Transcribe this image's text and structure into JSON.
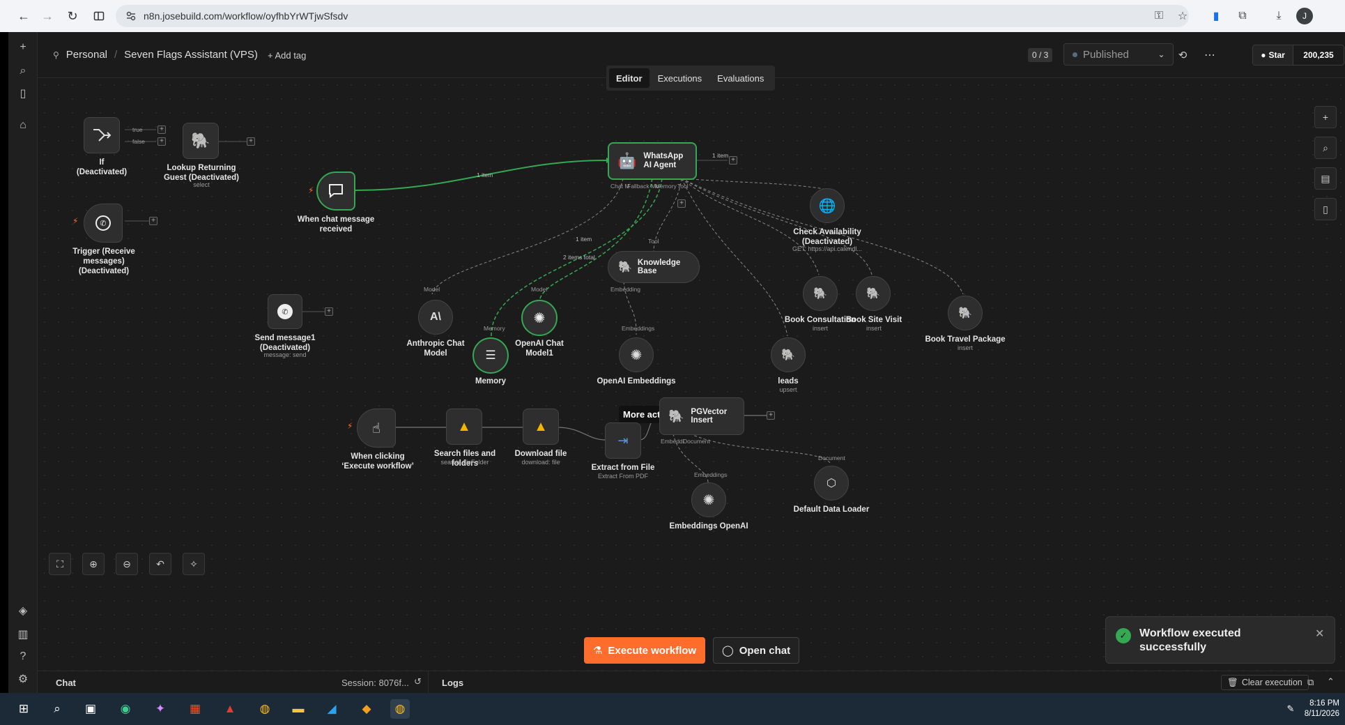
{
  "browser": {
    "url": "n8n.josebuild.com/workflow/oyfhbYrWTjwSfsdv",
    "profile_initial": "J"
  },
  "header": {
    "project": "Personal",
    "workflow_name": "Seven Flags Assistant (VPS)",
    "add_tag": "+ Add tag",
    "counter": "0 / 3",
    "published_label": "Published",
    "github_star": "Star",
    "github_count": "200,235"
  },
  "tabs": [
    {
      "label": "Editor",
      "active": true
    },
    {
      "label": "Executions",
      "active": false
    },
    {
      "label": "Evaluations",
      "active": false
    }
  ],
  "nodes": {
    "if_node": {
      "label": "If\n(Deactivated)",
      "out_true": "true",
      "out_false": "false"
    },
    "lookup": {
      "label": "Lookup Returning Guest (Deactivated)",
      "sub": "select"
    },
    "trigger_whatsapp": {
      "label": "Trigger (Receive messages) (Deactivated)"
    },
    "chat_trigger": {
      "label": "When chat message received"
    },
    "agent": {
      "label": "WhatsApp AI Agent",
      "out_label": "1 item",
      "ports": [
        "Chat M",
        "Fallback Mo",
        "Memory",
        "Tool"
      ]
    },
    "check_availability": {
      "label": "Check Availability (Deactivated)",
      "sub": "GET: https://api.calendl..."
    },
    "knowledge_base": {
      "label": "Knowledge Base",
      "port_top": "Tool",
      "port_bottom": "Embedding"
    },
    "send_message": {
      "label": "Send message1 (Deactivated)",
      "sub": "message: send"
    },
    "anthropic": {
      "label": "Anthropic Chat Model",
      "port": "Model"
    },
    "openai_chat": {
      "label": "OpenAI Chat Model1",
      "port": "Model"
    },
    "memory": {
      "label": "Memory",
      "port": "Memory"
    },
    "openai_embeddings": {
      "label": "OpenAI Embeddings",
      "port": "Embeddings"
    },
    "book_consultation": {
      "label": "Book Consultation",
      "sub": "insert"
    },
    "book_site_visit": {
      "label": "Book Site Visit",
      "sub": "insert"
    },
    "book_travel": {
      "label": "Book Travel Package",
      "sub": "insert"
    },
    "leads": {
      "label": "leads",
      "sub": "upsert"
    },
    "manual_trigger": {
      "label": "When clicking ‘Execute workflow’"
    },
    "search_files": {
      "label": "Search files and folders",
      "sub": "search: fileFolder"
    },
    "download_file": {
      "label": "Download file",
      "sub": "download: file"
    },
    "extract": {
      "label": "Extract from File",
      "sub": "Extract From PDF"
    },
    "pgvector": {
      "label": "PGVector Insert",
      "ports": [
        "Embeddi",
        "Document"
      ]
    },
    "embeddings_openai": {
      "label": "Embeddings OpenAI",
      "port": "Embeddings"
    },
    "data_loader": {
      "label": "Default Data Loader",
      "port": "Document"
    }
  },
  "edge_labels": {
    "chat_to_agent": "1 item",
    "memory_items": "2 items total",
    "model_item": "1 item"
  },
  "tooltip": "More actions",
  "actions": {
    "execute": "Execute workflow",
    "open_chat": "Open chat"
  },
  "toast": {
    "message": "Workflow executed successfully"
  },
  "bottom": {
    "chat": "Chat",
    "session": "Session: 8076f...",
    "logs": "Logs",
    "clear": "Clear execution"
  },
  "taskbar": {
    "time": "8:16 PM",
    "date": "8/11/2026"
  },
  "colors": {
    "accent": "#ff6d2c",
    "success": "#34a853",
    "canvas_bg": "#1b1b1b"
  }
}
